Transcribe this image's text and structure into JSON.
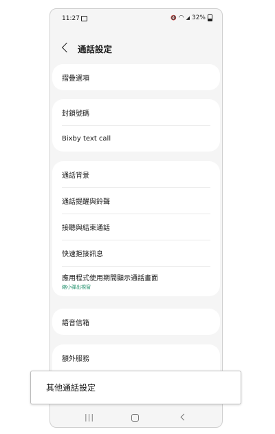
{
  "status_bar": {
    "time": "11:27",
    "mute": "🔇",
    "wifi": "◠",
    "signal": "◢",
    "battery": "32%"
  },
  "header": {
    "title": "通話設定"
  },
  "groups": [
    [
      "摺疊選項"
    ],
    [
      "封鎖號碼",
      "Bixby text call"
    ],
    [
      "通話背景",
      "通話提醒與鈴聲",
      "接聽與結束通話",
      "快速拒接訊息"
    ],
    [
      "語音信箱"
    ],
    [
      "額外服務"
    ]
  ],
  "app_usage": {
    "label": "應用程式使用期間顯示通話畫面",
    "sub": "縮小彈出視窗"
  },
  "overlay": {
    "label": "其他通話設定"
  },
  "navbar": {
    "recents": "|||"
  }
}
